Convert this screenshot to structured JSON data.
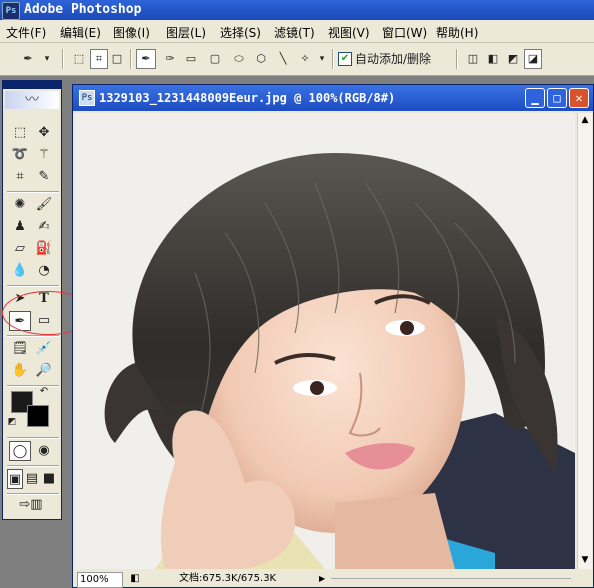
{
  "app": {
    "title": "Adobe Photoshop"
  },
  "menu": [
    "文件(F)",
    "编辑(E)",
    "图像(I)",
    "图层(L)",
    "选择(S)",
    "滤镜(T)",
    "视图(V)",
    "窗口(W)",
    "帮助(H)"
  ],
  "options": {
    "auto_add_delete_label": "自动添加/删除",
    "auto_add_delete_checked": true
  },
  "document": {
    "title": "1329103_1231448009Eeur.jpg @ 100%(RGB/8#)",
    "zoom": "100%",
    "doc_size": "文档:675.3K/675.3K"
  },
  "colors": {
    "title_bar": "#2e64d8",
    "window_close": "#d8532c",
    "annotation_circle": "#e8313b",
    "chrome_bg": "#ece9d8"
  },
  "icons": {
    "pen": "✒",
    "move": "✥",
    "type": "T",
    "hand": "✋",
    "zoom": "🔍"
  }
}
